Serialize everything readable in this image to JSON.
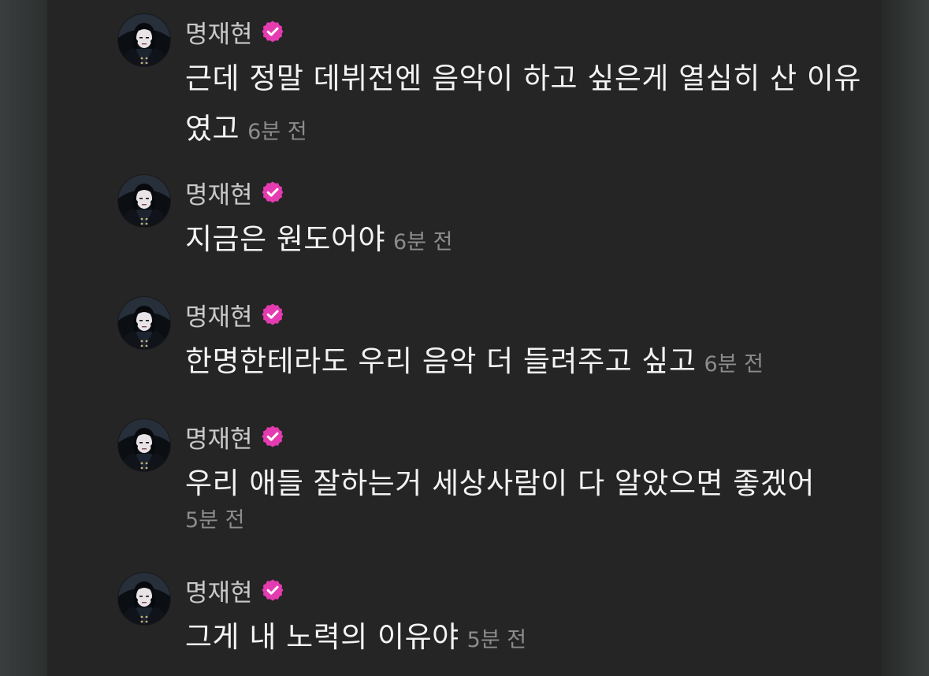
{
  "colors": {
    "verified_badge": "#e43bb0",
    "name_text": "#c9c9c9",
    "message_text": "#f3f3f3",
    "timestamp_text": "#8c8c8c"
  },
  "messages": [
    {
      "author": "명재현",
      "verified": true,
      "avatar_icon": "profile-photo-avatar",
      "text": "근데 정말 데뷔전엔 음악이 하고 싶은게 열심히 산 이유 였고",
      "time": "6분 전"
    },
    {
      "author": "명재현",
      "verified": true,
      "avatar_icon": "profile-photo-avatar",
      "text": "지금은 원도어야",
      "time": "6분 전"
    },
    {
      "author": "명재현",
      "verified": true,
      "avatar_icon": "profile-photo-avatar",
      "text": "한명한테라도 우리 음악 더 들려주고 싶고",
      "time": "6분 전"
    },
    {
      "author": "명재현",
      "verified": true,
      "avatar_icon": "profile-photo-avatar",
      "text": "우리 애들 잘하는거 세상사람이 다 알았으면 좋겠어",
      "time": "5분 전"
    },
    {
      "author": "명재현",
      "verified": true,
      "avatar_icon": "profile-photo-avatar",
      "text": "그게 내 노력의 이유야",
      "time": "5분 전"
    }
  ]
}
